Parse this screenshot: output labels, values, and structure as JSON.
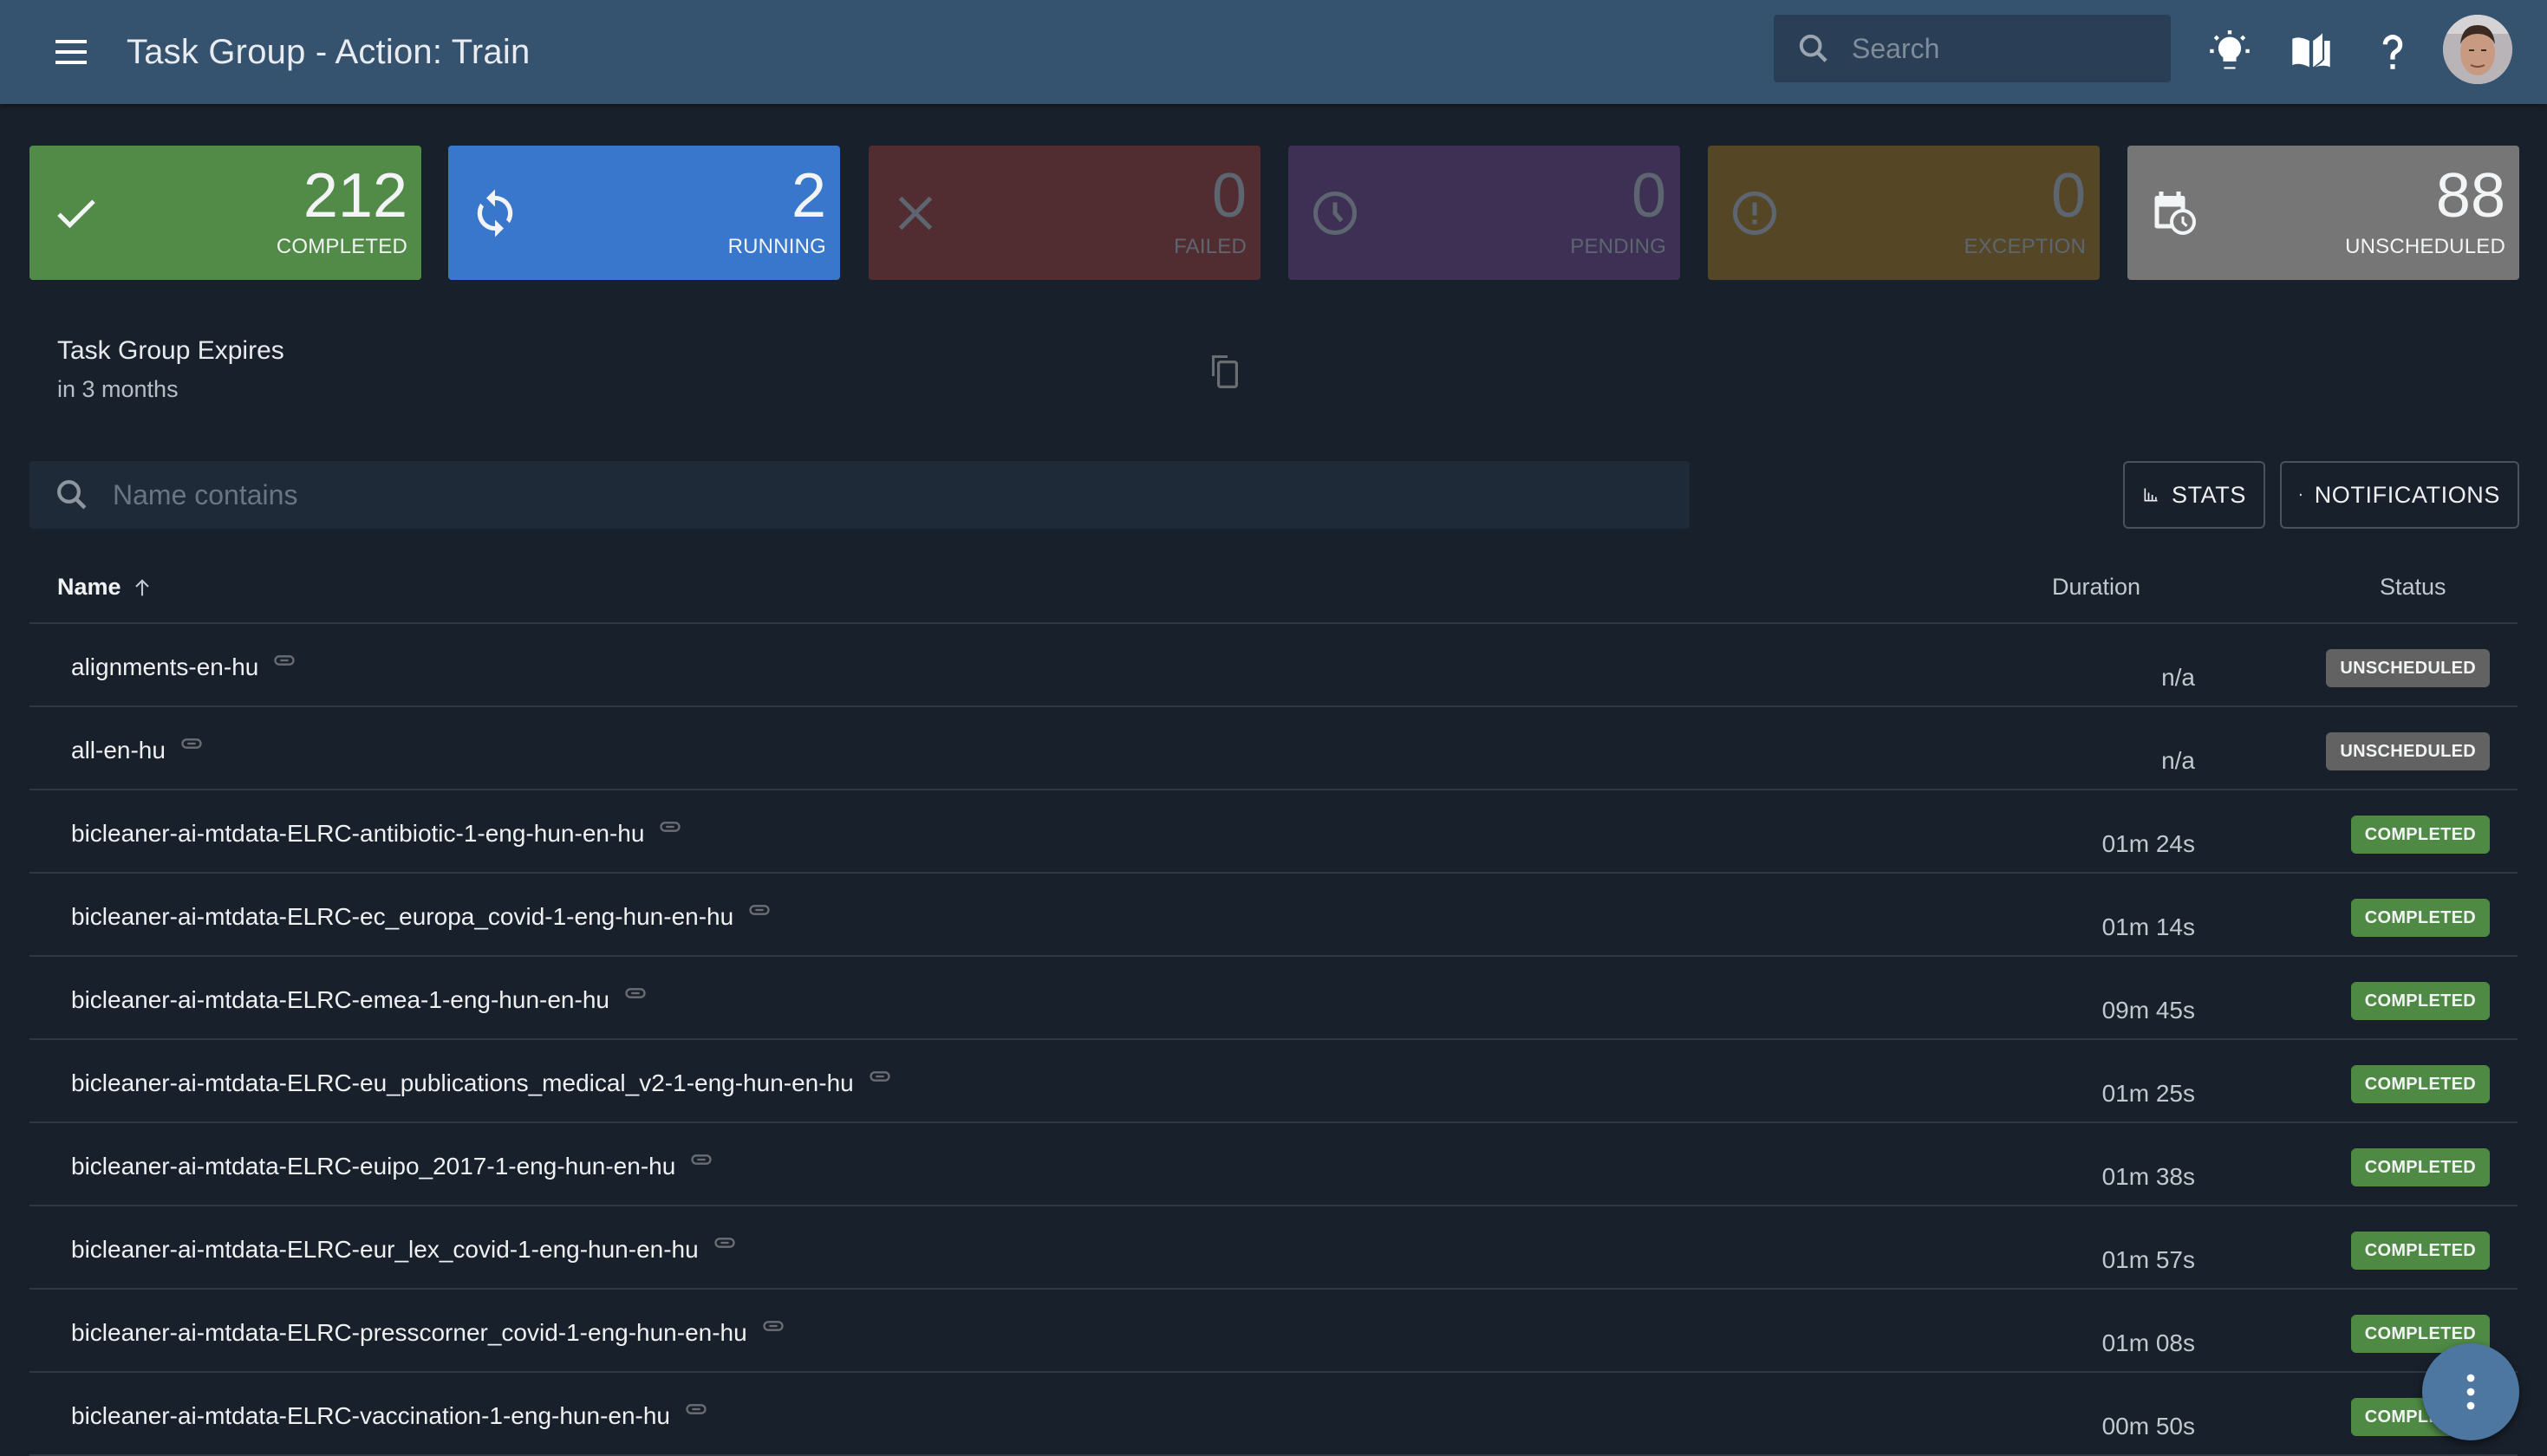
{
  "appbar": {
    "title": "Task Group - Action: Train",
    "search_placeholder": "Search",
    "icons": [
      "menu-icon",
      "lightbulb-icon",
      "book-icon",
      "help-icon",
      "avatar"
    ]
  },
  "stats": [
    {
      "count": "212",
      "label": "COMPLETED",
      "icon": "check-icon",
      "color": "#518b47",
      "active": true
    },
    {
      "count": "2",
      "label": "RUNNING",
      "icon": "sync-icon",
      "color": "#3877cc",
      "active": true
    },
    {
      "count": "0",
      "label": "FAILED",
      "icon": "close-icon",
      "color": "#512d32",
      "active": false
    },
    {
      "count": "0",
      "label": "PENDING",
      "icon": "clock-icon",
      "color": "#3e2f54",
      "active": false
    },
    {
      "count": "0",
      "label": "EXCEPTION",
      "icon": "alert-circle-icon",
      "color": "#554626",
      "active": false
    },
    {
      "count": "88",
      "label": "UNSCHEDULED",
      "icon": "calendar-clock-icon",
      "color": "#767676",
      "active": true
    }
  ],
  "expires": {
    "title": "Task Group Expires",
    "value": "in 3 months"
  },
  "filter": {
    "placeholder": "Name contains",
    "value": ""
  },
  "buttons": {
    "stats": "STATS",
    "notifications": "NOTIFICATIONS"
  },
  "table": {
    "columns": {
      "name": "Name",
      "duration": "Duration",
      "status": "Status"
    },
    "sort": "ascending",
    "rows": [
      {
        "name": "alignments-en-hu",
        "duration": "n/a",
        "status": "UNSCHEDULED"
      },
      {
        "name": "all-en-hu",
        "duration": "n/a",
        "status": "UNSCHEDULED"
      },
      {
        "name": "bicleaner-ai-mtdata-ELRC-antibiotic-1-eng-hun-en-hu",
        "duration": "01m 24s",
        "status": "COMPLETED"
      },
      {
        "name": "bicleaner-ai-mtdata-ELRC-ec_europa_covid-1-eng-hun-en-hu",
        "duration": "01m 14s",
        "status": "COMPLETED"
      },
      {
        "name": "bicleaner-ai-mtdata-ELRC-emea-1-eng-hun-en-hu",
        "duration": "09m 45s",
        "status": "COMPLETED"
      },
      {
        "name": "bicleaner-ai-mtdata-ELRC-eu_publications_medical_v2-1-eng-hun-en-hu",
        "duration": "01m 25s",
        "status": "COMPLETED"
      },
      {
        "name": "bicleaner-ai-mtdata-ELRC-euipo_2017-1-eng-hun-en-hu",
        "duration": "01m 38s",
        "status": "COMPLETED"
      },
      {
        "name": "bicleaner-ai-mtdata-ELRC-eur_lex_covid-1-eng-hun-en-hu",
        "duration": "01m 57s",
        "status": "COMPLETED"
      },
      {
        "name": "bicleaner-ai-mtdata-ELRC-presscorner_covid-1-eng-hun-en-hu",
        "duration": "01m 08s",
        "status": "COMPLETED"
      },
      {
        "name": "bicleaner-ai-mtdata-ELRC-vaccination-1-eng-hun-en-hu",
        "duration": "00m 50s",
        "status": "COMPLETED"
      }
    ]
  },
  "fab": {
    "icon": "more-vertical-icon"
  }
}
